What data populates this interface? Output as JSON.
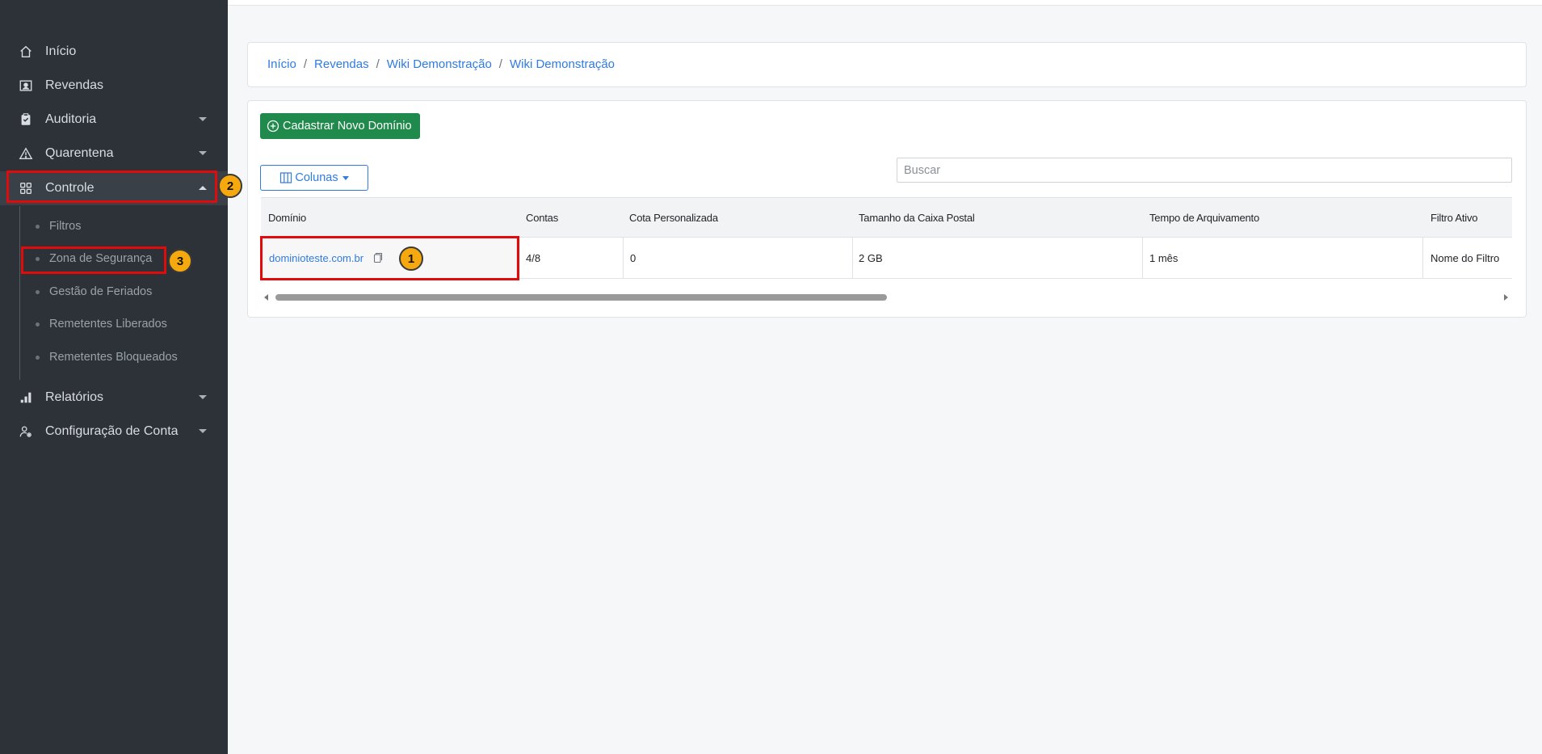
{
  "sidebar": {
    "items": [
      {
        "label": "Início",
        "icon": "home-icon"
      },
      {
        "label": "Revendas",
        "icon": "contact-card-icon"
      },
      {
        "label": "Auditoria",
        "icon": "clipboard-icon"
      },
      {
        "label": "Quarentena",
        "icon": "warning-icon"
      },
      {
        "label": "Controle",
        "icon": "grid-icon"
      },
      {
        "label": "Relatórios",
        "icon": "bar-chart-icon"
      },
      {
        "label": "Configuração de Conta",
        "icon": "user-settings-icon"
      }
    ],
    "subitems": [
      {
        "label": "Filtros"
      },
      {
        "label": "Zona de Segurança"
      },
      {
        "label": "Gestão de Feriados"
      },
      {
        "label": "Remetentes Liberados"
      },
      {
        "label": "Remetentes Bloqueados"
      }
    ]
  },
  "breadcrumb": [
    "Início",
    "Revendas",
    "Wiki Demonstração",
    "Wiki Demonstração"
  ],
  "breadcrumb_separator": "/",
  "toolbar": {
    "new_domain_label": "Cadastrar Novo Domínio",
    "columns_label": "Colunas",
    "search_placeholder": "Buscar"
  },
  "table": {
    "columns": [
      "Domínio",
      "Contas",
      "Cota Personalizada",
      "Tamanho da Caixa Postal",
      "Tempo de Arquivamento",
      "Filtro Ativo"
    ],
    "rows": [
      [
        "dominioteste.com.br",
        "4/8",
        "0",
        "2 GB",
        "1 mês",
        "Nome do Filtro"
      ]
    ],
    "scroll_position": 0.0
  },
  "annotations": [
    "1",
    "2",
    "3"
  ],
  "colors": {
    "sidebar_bg": "#2c3238",
    "accent_blue": "#2f7be0",
    "primary_green": "#1f8a4c",
    "highlight_red": "#e10b0b",
    "badge_orange": "#f6a80f"
  }
}
